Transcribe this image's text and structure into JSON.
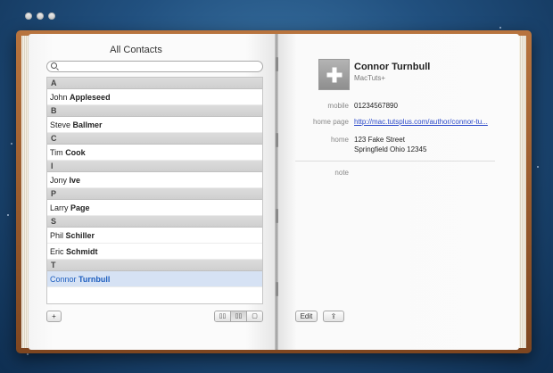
{
  "window": {
    "title": "All Contacts"
  },
  "search": {
    "placeholder": ""
  },
  "contacts": [
    {
      "header": "A",
      "rows": [
        {
          "first": "John",
          "last": "Appleseed"
        }
      ]
    },
    {
      "header": "B",
      "rows": [
        {
          "first": "Steve",
          "last": "Ballmer"
        }
      ]
    },
    {
      "header": "C",
      "rows": [
        {
          "first": "Tim",
          "last": "Cook"
        }
      ]
    },
    {
      "header": "I",
      "rows": [
        {
          "first": "Jony",
          "last": "Ive"
        }
      ]
    },
    {
      "header": "P",
      "rows": [
        {
          "first": "Larry",
          "last": "Page"
        }
      ]
    },
    {
      "header": "S",
      "rows": [
        {
          "first": "Phil",
          "last": "Schiller"
        },
        {
          "first": "Eric",
          "last": "Schmidt"
        }
      ]
    },
    {
      "header": "T",
      "rows": [
        {
          "first": "Connor",
          "last": "Turnbull",
          "selected": true
        }
      ]
    }
  ],
  "footer_left": {
    "add_label": "+",
    "view_buttons": [
      "▯▯",
      "▯▯",
      "▢"
    ]
  },
  "detail": {
    "name": "Connor Turnbull",
    "company": "MacTuts+",
    "mobile_label": "mobile",
    "mobile_value": "01234567890",
    "homepage_label": "home page",
    "homepage_value": "http://mac.tutsplus.com/author/connor-tu...",
    "home_label": "home",
    "home_line1": "123 Fake Street",
    "home_line2": "Springfield Ohio 12345",
    "note_label": "note",
    "edit_label": "Edit",
    "share_label": "⇪"
  },
  "colors": {
    "accent": "#1f5fbf",
    "link": "#2a48c9",
    "selection": "#d6e2f4",
    "book": "#9a5c2e"
  }
}
